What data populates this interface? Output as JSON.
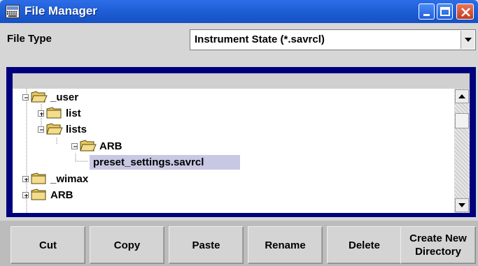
{
  "window": {
    "title": "File Manager",
    "icon": "keyboard-icon"
  },
  "file_type": {
    "label": "File Type",
    "selected": "Instrument State (*.savrcl)"
  },
  "tree": {
    "items": [
      {
        "label": "_user",
        "expander": "minus",
        "icon": "open-folder-icon"
      },
      {
        "label": "list",
        "expander": "plus",
        "icon": "closed-folder-icon"
      },
      {
        "label": "lists",
        "expander": "minus",
        "icon": "open-folder-icon"
      },
      {
        "label": "ARB",
        "expander": "minus",
        "icon": "open-folder-icon"
      },
      {
        "label": "preset_settings.savrcl",
        "expander": "none",
        "icon": "none",
        "selected": true
      },
      {
        "label": "_wimax",
        "expander": "plus",
        "icon": "closed-folder-icon"
      },
      {
        "label": "ARB",
        "expander": "plus",
        "icon": "closed-folder-icon"
      }
    ]
  },
  "buttons": {
    "cut": "Cut",
    "copy": "Copy",
    "paste": "Paste",
    "rename": "Rename",
    "delete": "Delete",
    "create_line1": "Create New",
    "create_line2": "Directory"
  }
}
